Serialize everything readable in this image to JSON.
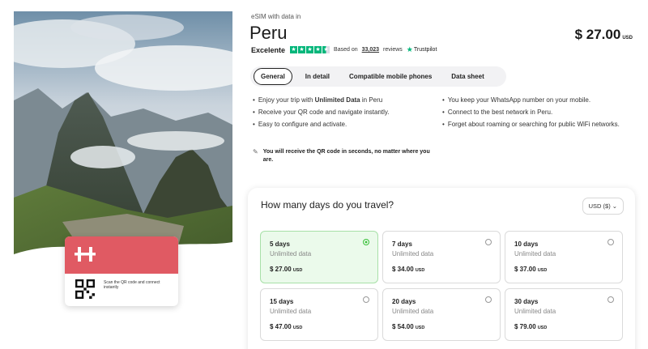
{
  "product": {
    "subtitle": "eSIM with data in",
    "title": "Peru",
    "price_amount": "$ 27.00",
    "price_currency": "USD"
  },
  "rating": {
    "label": "Excelente",
    "stars": 4.5,
    "based_on": "Based on",
    "count": "33,023",
    "reviews": "reviews",
    "brand": "Trustpilot"
  },
  "tabs": [
    {
      "label": "General",
      "active": true
    },
    {
      "label": "In detail",
      "active": false
    },
    {
      "label": "Compatible mobile phones",
      "active": false
    },
    {
      "label": "Data sheet",
      "active": false
    }
  ],
  "features_left": {
    "item1_pre": "Enjoy your trip with ",
    "item1_bold": "Unlimited Data",
    "item1_post": " in Peru",
    "item2": "Receive your QR code and navigate instantly.",
    "item3": "Easy to configure and activate."
  },
  "features_right": {
    "item1": "You keep your WhatsApp number on your mobile.",
    "item2": "Connect to the best network in Peru.",
    "item3": "Forget about roaming or searching for public WiFi networks."
  },
  "qr_note": "You will receive the QR code in seconds, no matter where you are.",
  "card": {
    "scan_text": "Scan the QR code and connect instantly"
  },
  "plans": {
    "heading": "How many days do you travel?",
    "currency_select": "USD ($)",
    "items": [
      {
        "days": "5 days",
        "data": "Unlimited data",
        "price": "$ 27.00",
        "currency": "USD",
        "selected": true
      },
      {
        "days": "7 days",
        "data": "Unlimited data",
        "price": "$ 34.00",
        "currency": "USD",
        "selected": false
      },
      {
        "days": "10 days",
        "data": "Unlimited data",
        "price": "$ 37.00",
        "currency": "USD",
        "selected": false
      },
      {
        "days": "15 days",
        "data": "Unlimited data",
        "price": "$ 47.00",
        "currency": "USD",
        "selected": false
      },
      {
        "days": "20 days",
        "data": "Unlimited data",
        "price": "$ 54.00",
        "currency": "USD",
        "selected": false
      },
      {
        "days": "30 days",
        "data": "Unlimited data",
        "price": "$ 79.00",
        "currency": "USD",
        "selected": false
      }
    ]
  },
  "colors": {
    "brand_red": "#e05a63",
    "trustpilot_green": "#00b67a",
    "selected_bg": "#ebfaeb",
    "selected_radio": "#3cc13c"
  }
}
